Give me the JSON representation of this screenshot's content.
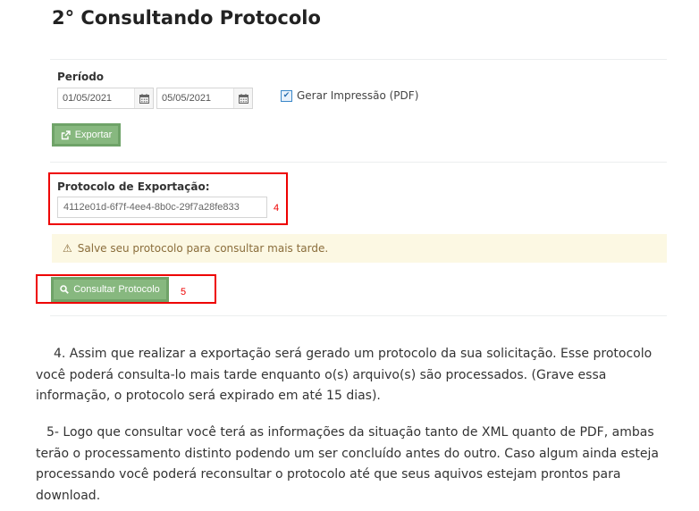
{
  "title": "2° Consultando Protocolo",
  "form": {
    "periodo_label": "Período",
    "date_start": "01/05/2021",
    "date_end": "05/05/2021",
    "gerar_label": "Gerar Impressão (PDF)",
    "gerar_checked": true,
    "exportar_label": "Exportar",
    "protocolo_label": "Protocolo de Exportação:",
    "protocolo_value": "4112e01d-6f7f-4ee4-8b0c-29f7a28fe833",
    "marker_4": "4",
    "alert_text": "Salve seu protocolo para consultar mais tarde.",
    "consultar_label": "Consultar Protocolo",
    "marker_5": "5"
  },
  "paragraphs": {
    "p4": "4. Assim que realizar a exportação será gerado um protocolo da sua solicitação. Esse protocolo você poderá consulta-lo mais tarde enquanto o(s) arquivo(s) são processados. (Grave essa informação, o protocolo será expirado em até 15 dias).",
    "p5": "5- Logo que consultar você terá as informações da situação tanto de XML quanto de PDF, ambas terão o processamento distinto podendo um ser concluído antes do outro. Caso algum ainda esteja processando você poderá reconsultar o protocolo até que seus aquivos estejam prontos para download."
  },
  "colors": {
    "button_green": "#87b87f",
    "highlight_red": "#e00000",
    "alert_bg": "#fcf8e3"
  }
}
